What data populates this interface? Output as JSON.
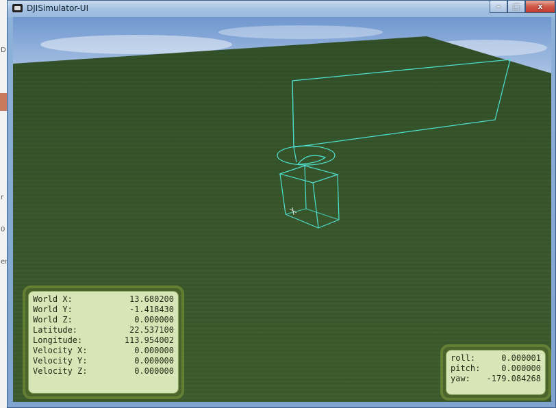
{
  "window": {
    "title": "DJISimulator-UI",
    "buttons": {
      "minimize": "–",
      "maximize": "□",
      "close": "x"
    }
  },
  "background_app_glyphs": [
    "D",
    "r",
    "0",
    "er"
  ],
  "world_panel": [
    {
      "label": "World X:",
      "value": "13.680200"
    },
    {
      "label": "World Y:",
      "value": "-1.418430"
    },
    {
      "label": "World Z:",
      "value": "0.000000"
    },
    {
      "label": "Latitude:",
      "value": "22.537100"
    },
    {
      "label": "Longitude:",
      "value": "113.954002"
    },
    {
      "label": "Velocity X:",
      "value": "0.000000"
    },
    {
      "label": "Velocity Y:",
      "value": "0.000000"
    },
    {
      "label": "Velocity Z:",
      "value": "0.000000"
    }
  ],
  "attitude_panel": [
    {
      "label": "roll:",
      "value": "0.000001"
    },
    {
      "label": "pitch:",
      "value": "0.000000"
    },
    {
      "label": "yaw:",
      "value": "-179.084268"
    }
  ],
  "colors": {
    "wireframe": "#4fe0d0",
    "ground": "#3b5a2b",
    "sky": "#8fb0dc",
    "panel_bg": "#d7e6b6"
  }
}
